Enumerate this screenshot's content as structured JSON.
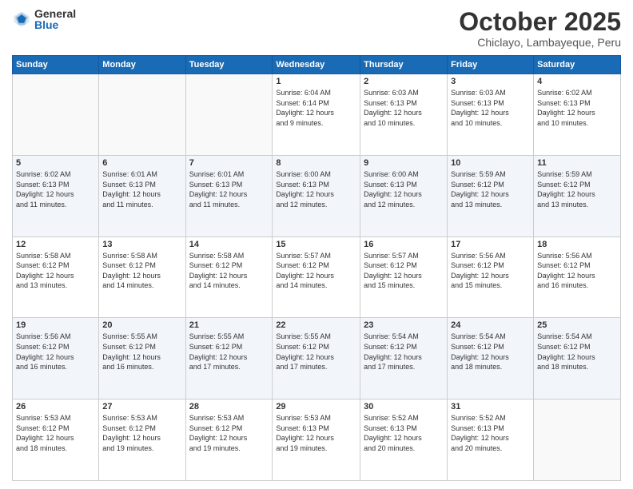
{
  "header": {
    "logo_general": "General",
    "logo_blue": "Blue",
    "month": "October 2025",
    "location": "Chiclayo, Lambayeque, Peru"
  },
  "weekdays": [
    "Sunday",
    "Monday",
    "Tuesday",
    "Wednesday",
    "Thursday",
    "Friday",
    "Saturday"
  ],
  "weeks": [
    [
      {
        "day": "",
        "info": ""
      },
      {
        "day": "",
        "info": ""
      },
      {
        "day": "",
        "info": ""
      },
      {
        "day": "1",
        "info": "Sunrise: 6:04 AM\nSunset: 6:14 PM\nDaylight: 12 hours\nand 9 minutes."
      },
      {
        "day": "2",
        "info": "Sunrise: 6:03 AM\nSunset: 6:13 PM\nDaylight: 12 hours\nand 10 minutes."
      },
      {
        "day": "3",
        "info": "Sunrise: 6:03 AM\nSunset: 6:13 PM\nDaylight: 12 hours\nand 10 minutes."
      },
      {
        "day": "4",
        "info": "Sunrise: 6:02 AM\nSunset: 6:13 PM\nDaylight: 12 hours\nand 10 minutes."
      }
    ],
    [
      {
        "day": "5",
        "info": "Sunrise: 6:02 AM\nSunset: 6:13 PM\nDaylight: 12 hours\nand 11 minutes."
      },
      {
        "day": "6",
        "info": "Sunrise: 6:01 AM\nSunset: 6:13 PM\nDaylight: 12 hours\nand 11 minutes."
      },
      {
        "day": "7",
        "info": "Sunrise: 6:01 AM\nSunset: 6:13 PM\nDaylight: 12 hours\nand 11 minutes."
      },
      {
        "day": "8",
        "info": "Sunrise: 6:00 AM\nSunset: 6:13 PM\nDaylight: 12 hours\nand 12 minutes."
      },
      {
        "day": "9",
        "info": "Sunrise: 6:00 AM\nSunset: 6:13 PM\nDaylight: 12 hours\nand 12 minutes."
      },
      {
        "day": "10",
        "info": "Sunrise: 5:59 AM\nSunset: 6:12 PM\nDaylight: 12 hours\nand 13 minutes."
      },
      {
        "day": "11",
        "info": "Sunrise: 5:59 AM\nSunset: 6:12 PM\nDaylight: 12 hours\nand 13 minutes."
      }
    ],
    [
      {
        "day": "12",
        "info": "Sunrise: 5:58 AM\nSunset: 6:12 PM\nDaylight: 12 hours\nand 13 minutes."
      },
      {
        "day": "13",
        "info": "Sunrise: 5:58 AM\nSunset: 6:12 PM\nDaylight: 12 hours\nand 14 minutes."
      },
      {
        "day": "14",
        "info": "Sunrise: 5:58 AM\nSunset: 6:12 PM\nDaylight: 12 hours\nand 14 minutes."
      },
      {
        "day": "15",
        "info": "Sunrise: 5:57 AM\nSunset: 6:12 PM\nDaylight: 12 hours\nand 14 minutes."
      },
      {
        "day": "16",
        "info": "Sunrise: 5:57 AM\nSunset: 6:12 PM\nDaylight: 12 hours\nand 15 minutes."
      },
      {
        "day": "17",
        "info": "Sunrise: 5:56 AM\nSunset: 6:12 PM\nDaylight: 12 hours\nand 15 minutes."
      },
      {
        "day": "18",
        "info": "Sunrise: 5:56 AM\nSunset: 6:12 PM\nDaylight: 12 hours\nand 16 minutes."
      }
    ],
    [
      {
        "day": "19",
        "info": "Sunrise: 5:56 AM\nSunset: 6:12 PM\nDaylight: 12 hours\nand 16 minutes."
      },
      {
        "day": "20",
        "info": "Sunrise: 5:55 AM\nSunset: 6:12 PM\nDaylight: 12 hours\nand 16 minutes."
      },
      {
        "day": "21",
        "info": "Sunrise: 5:55 AM\nSunset: 6:12 PM\nDaylight: 12 hours\nand 17 minutes."
      },
      {
        "day": "22",
        "info": "Sunrise: 5:55 AM\nSunset: 6:12 PM\nDaylight: 12 hours\nand 17 minutes."
      },
      {
        "day": "23",
        "info": "Sunrise: 5:54 AM\nSunset: 6:12 PM\nDaylight: 12 hours\nand 17 minutes."
      },
      {
        "day": "24",
        "info": "Sunrise: 5:54 AM\nSunset: 6:12 PM\nDaylight: 12 hours\nand 18 minutes."
      },
      {
        "day": "25",
        "info": "Sunrise: 5:54 AM\nSunset: 6:12 PM\nDaylight: 12 hours\nand 18 minutes."
      }
    ],
    [
      {
        "day": "26",
        "info": "Sunrise: 5:53 AM\nSunset: 6:12 PM\nDaylight: 12 hours\nand 18 minutes."
      },
      {
        "day": "27",
        "info": "Sunrise: 5:53 AM\nSunset: 6:12 PM\nDaylight: 12 hours\nand 19 minutes."
      },
      {
        "day": "28",
        "info": "Sunrise: 5:53 AM\nSunset: 6:12 PM\nDaylight: 12 hours\nand 19 minutes."
      },
      {
        "day": "29",
        "info": "Sunrise: 5:53 AM\nSunset: 6:13 PM\nDaylight: 12 hours\nand 19 minutes."
      },
      {
        "day": "30",
        "info": "Sunrise: 5:52 AM\nSunset: 6:13 PM\nDaylight: 12 hours\nand 20 minutes."
      },
      {
        "day": "31",
        "info": "Sunrise: 5:52 AM\nSunset: 6:13 PM\nDaylight: 12 hours\nand 20 minutes."
      },
      {
        "day": "",
        "info": ""
      }
    ]
  ]
}
